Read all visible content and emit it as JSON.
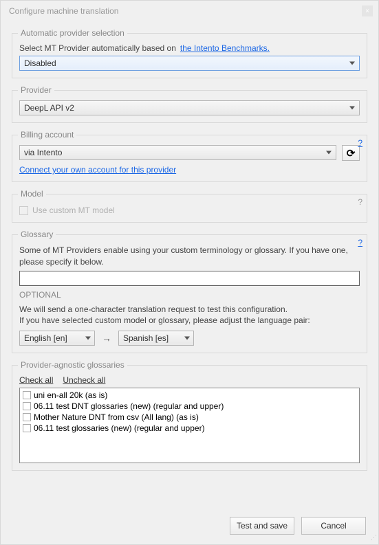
{
  "window": {
    "title": "Configure machine translation"
  },
  "auto_provider": {
    "legend": "Automatic provider selection",
    "label": "Select MT Provider automatically based on",
    "link": "the Intento Benchmarks.",
    "value": "Disabled"
  },
  "provider": {
    "legend": "Provider",
    "value": "DeepL API v2"
  },
  "billing": {
    "legend": "Billing account",
    "help": "?",
    "value": "via Intento",
    "connect_link": "Connect your own account for this provider"
  },
  "model": {
    "legend": "Model",
    "help": "?",
    "checkbox_label": "Use custom MT model"
  },
  "glossary": {
    "legend": "Glossary",
    "help": "?",
    "desc": "Some of MT Providers enable using your custom terminology or glossary. If you have one, please specify it below.",
    "input_value": ""
  },
  "optional": {
    "heading": "OPTIONAL",
    "line1": "We will send a one-character translation request to test this configuration.",
    "line2": "If you have selected custom model or glossary, please adjust the language pair:",
    "from": "English [en]",
    "to": "Spanish [es]"
  },
  "pag": {
    "legend": "Provider-agnostic glossaries",
    "check_all": "Check all",
    "uncheck_all": "Uncheck all",
    "items": [
      "uni en-all 20k (as is)",
      "06.11 test DNT glossaries (new) (regular and upper)",
      "Mother Nature DNT from csv (All lang) (as is)",
      "06.11 test glossaries (new) (regular and upper)"
    ]
  },
  "buttons": {
    "test_save": "Test and save",
    "cancel": "Cancel"
  }
}
